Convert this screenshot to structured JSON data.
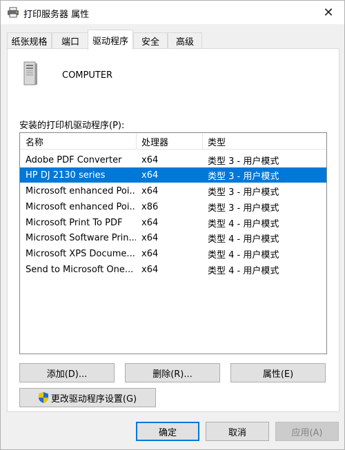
{
  "window": {
    "title": "打印服务器 属性",
    "close_glyph": "✕"
  },
  "tabs": [
    {
      "label": "纸张规格"
    },
    {
      "label": "端口"
    },
    {
      "label": "驱动程序"
    },
    {
      "label": "安全"
    },
    {
      "label": "高级"
    }
  ],
  "server": {
    "name": "COMPUTER"
  },
  "drivers": {
    "label": "安装的打印机驱动程序(P):",
    "columns": {
      "name": "名称",
      "processor": "处理器",
      "type": "类型"
    },
    "rows": [
      {
        "name": "Adobe PDF Converter",
        "processor": "x64",
        "type": "类型 3 - 用户模式"
      },
      {
        "name": "HP DJ 2130 series",
        "processor": "x64",
        "type": "类型 3 - 用户模式"
      },
      {
        "name": "Microsoft enhanced Poi...",
        "processor": "x64",
        "type": "类型 3 - 用户模式"
      },
      {
        "name": "Microsoft enhanced Poi...",
        "processor": "x86",
        "type": "类型 3 - 用户模式"
      },
      {
        "name": "Microsoft Print To PDF",
        "processor": "x64",
        "type": "类型 4 - 用户模式"
      },
      {
        "name": "Microsoft Software Prin...",
        "processor": "x64",
        "type": "类型 4 - 用户模式"
      },
      {
        "name": "Microsoft XPS Docume...",
        "processor": "x64",
        "type": "类型 4 - 用户模式"
      },
      {
        "name": "Send to Microsoft One...",
        "processor": "x64",
        "type": "类型 4 - 用户模式"
      }
    ]
  },
  "buttons": {
    "add": "添加(D)...",
    "remove": "删除(R)...",
    "properties": "属性(E)",
    "change_settings": "更改驱动程序设置(G)",
    "ok": "确定",
    "cancel": "取消",
    "apply": "应用(A)"
  },
  "colors": {
    "selection": "#0078d7",
    "shield_blue": "#1f6fc5",
    "shield_yellow": "#f2c200"
  }
}
